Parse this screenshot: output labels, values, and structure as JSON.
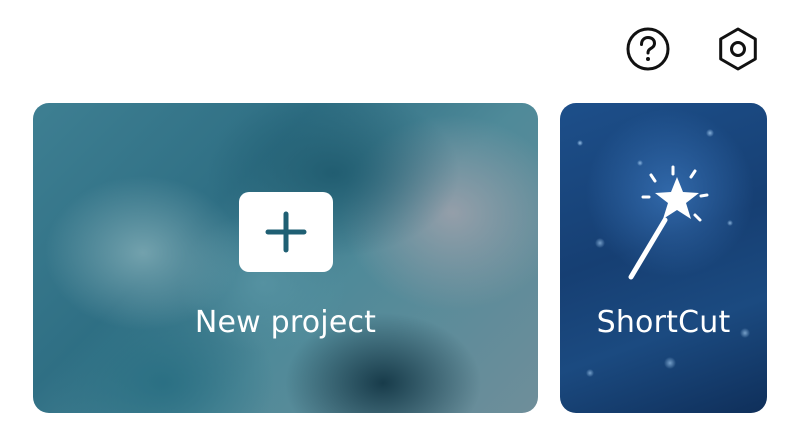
{
  "header": {
    "help_icon": "question-circle-icon",
    "settings_icon": "hexagon-gear-icon"
  },
  "cards": {
    "new_project": {
      "label": "New project",
      "icon": "plus-icon"
    },
    "shortcut": {
      "label": "ShortCut",
      "icon": "magic-wand-icon"
    }
  },
  "colors": {
    "plus_icon": "#1f5f73",
    "icon_stroke": "#111111",
    "card_text": "#ffffff"
  }
}
